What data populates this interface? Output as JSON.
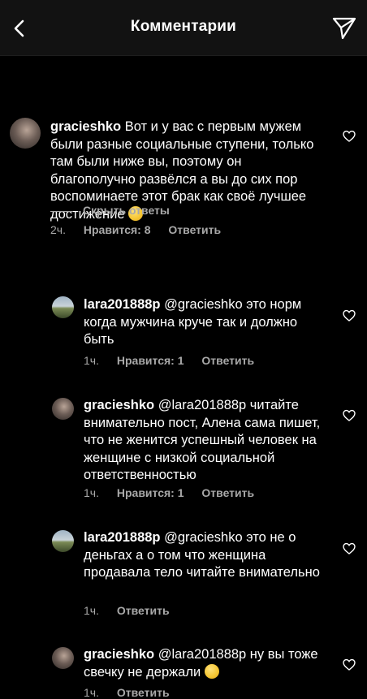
{
  "header": {
    "title": "Комментарии"
  },
  "comments": [
    {
      "username": "gracieshko",
      "text": "Вот и у вас с первым мужем были разные социальные ступени, только там были ниже вы, поэтому он благополучно развёлся а вы до сих пор воспоминаете этот брак как своё лучшее достижение",
      "emoji": "thinking-face-icon",
      "time": "2ч.",
      "likes": "Нравится: 8",
      "reply": "Ответить"
    },
    {
      "username": "lara201888p",
      "text": "@gracieshko это норм когда мужчина круче так и должно быть",
      "time": "1ч.",
      "likes": "Нравится: 1",
      "reply": "Ответить"
    },
    {
      "username": "gracieshko",
      "text": "@lara201888p читайте внимательно пост, Алена сама пишет, что не женится успешный человек на женщине с низкой социальной ответственностью",
      "time": "1ч.",
      "likes": "Нравится: 1",
      "reply": "Ответить"
    },
    {
      "username": "lara201888p",
      "text": "@gracieshko это не о деньгах а о том что женщина продавала тело читайте внимательно",
      "time": "1ч.",
      "reply": "Ответить"
    },
    {
      "username": "gracieshko",
      "text": "@lara201888p ну вы тоже свечку не держали",
      "emoji": "thinking-face-icon",
      "time": "1ч.",
      "reply": "Ответить"
    }
  ],
  "hide_replies_label": "Скрыть ответы"
}
